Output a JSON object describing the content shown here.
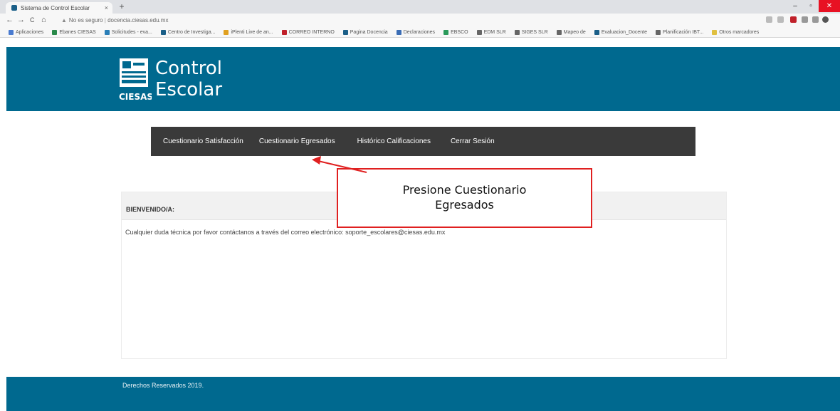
{
  "browser": {
    "tab_title": "Sistema de Control Escolar",
    "tab_close": "×",
    "new_tab": "+",
    "window_controls": {
      "minimize": "–",
      "maximize": "▫",
      "close": "✕"
    },
    "nav": {
      "back": "←",
      "forward": "→",
      "reload": "C",
      "home": "⌂"
    },
    "security_label": "No es seguro",
    "url": "docencia.ciesas.edu.mx",
    "bookmarks": [
      "Aplicaciones",
      "Ebanes CIESAS",
      "Solicitudes - eva...",
      "Centro de Investiga...",
      "iPlenti Live de an...",
      "CORREO INTERNO",
      "Pagina Docencia",
      "Declaraciones",
      "EBSCO",
      "EDM SLR",
      "SIGES SLR",
      "Mapeo de",
      "Evaluacion_Docente",
      "Planificación IBT...",
      "Otros marcadores"
    ]
  },
  "header": {
    "logo_line1": "Control",
    "logo_line2": "Escolar",
    "logo_mark_text": "CIESAS",
    "color": "#00698f"
  },
  "menu": {
    "items": [
      "Cuestionario Satisfacción",
      "Cuestionario Egresados",
      "Histórico Calificaciones",
      "Cerrar Sesión"
    ]
  },
  "annotation": {
    "line1": "Presione Cuestionario",
    "line2": "Egresados",
    "color": "#e02020"
  },
  "panel": {
    "title": "BIENVENIDO/A:",
    "message": "Cualquier duda técnica por favor contáctanos a través del correo electrónico: soporte_escolares@ciesas.edu.mx"
  },
  "footer": {
    "text": "Derechos Reservados 2019."
  }
}
